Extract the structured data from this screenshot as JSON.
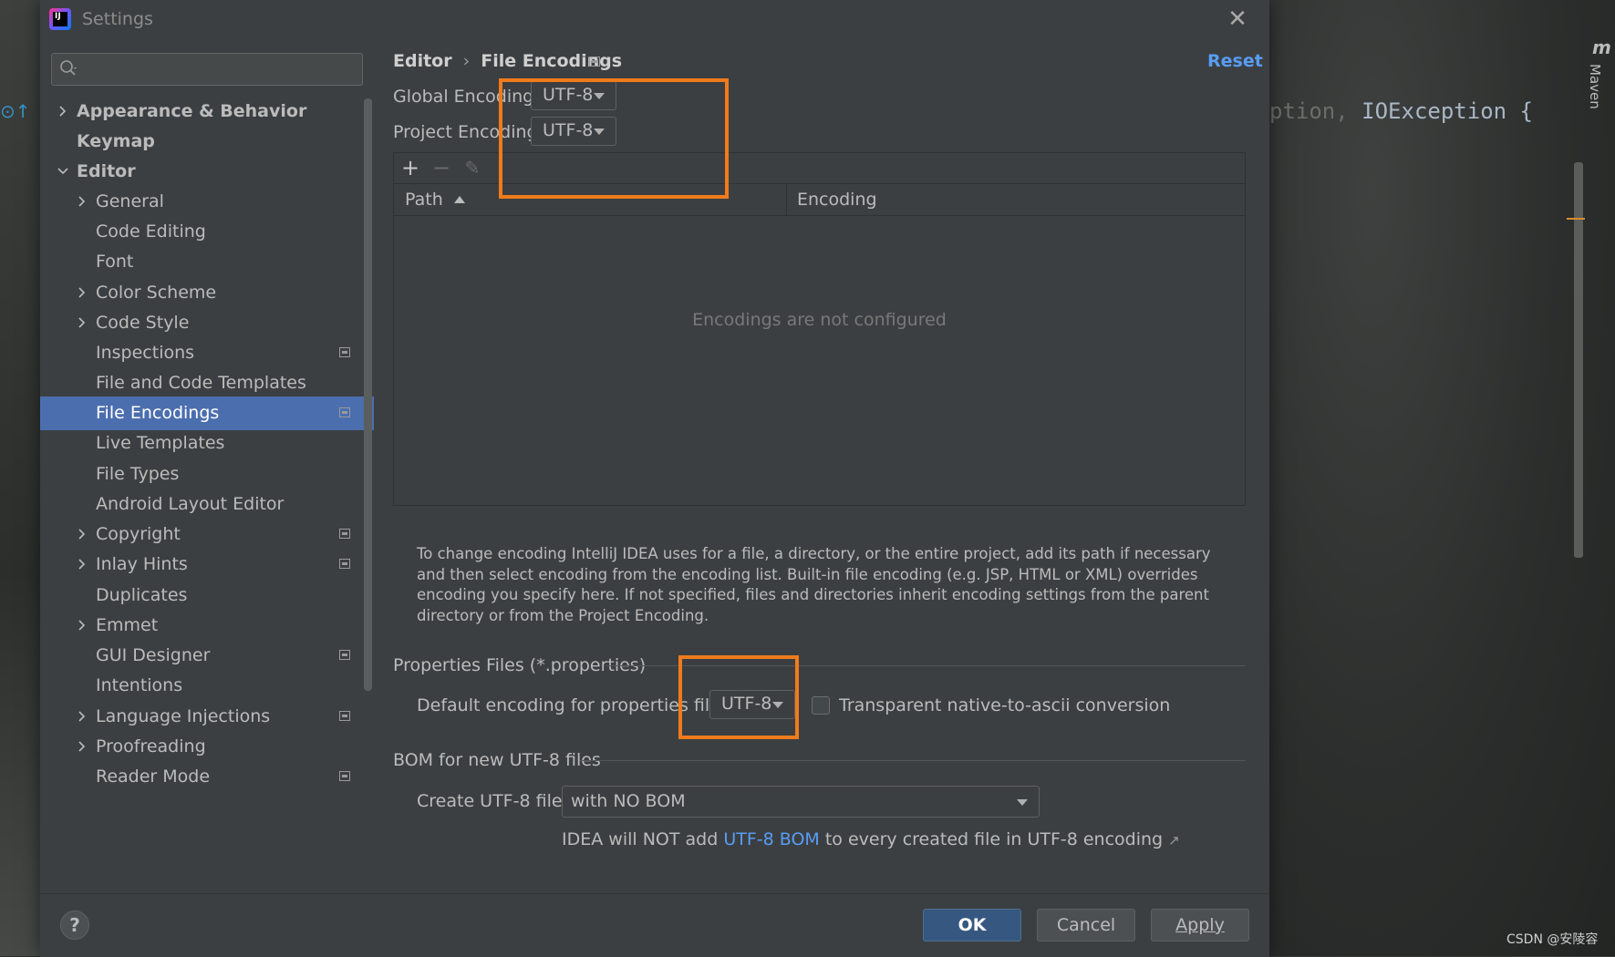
{
  "dialog": {
    "title": "Settings",
    "search_placeholder": ""
  },
  "sidebar": {
    "items": [
      {
        "label": "Appearance & Behavior"
      },
      {
        "label": "Keymap"
      },
      {
        "label": "Editor"
      },
      {
        "label": "General"
      },
      {
        "label": "Code Editing"
      },
      {
        "label": "Font"
      },
      {
        "label": "Color Scheme"
      },
      {
        "label": "Code Style"
      },
      {
        "label": "Inspections"
      },
      {
        "label": "File and Code Templates"
      },
      {
        "label": "File Encodings"
      },
      {
        "label": "Live Templates"
      },
      {
        "label": "File Types"
      },
      {
        "label": "Android Layout Editor"
      },
      {
        "label": "Copyright"
      },
      {
        "label": "Inlay Hints"
      },
      {
        "label": "Duplicates"
      },
      {
        "label": "Emmet"
      },
      {
        "label": "GUI Designer"
      },
      {
        "label": "Intentions"
      },
      {
        "label": "Language Injections"
      },
      {
        "label": "Proofreading"
      },
      {
        "label": "Reader Mode"
      }
    ],
    "selected": "File Encodings"
  },
  "header": {
    "breadcrumb_parent": "Editor",
    "breadcrumb_sep": "›",
    "breadcrumb_current": "File Encodings",
    "reset_label": "Reset"
  },
  "encodings": {
    "global_label": "Global Encoding:",
    "global_value": "UTF-8",
    "project_label": "Project Encoding:",
    "project_value": "UTF-8"
  },
  "toolbar": {
    "add": "+",
    "remove": "−",
    "edit": "✎"
  },
  "table": {
    "columns": [
      "Path",
      "Encoding"
    ],
    "empty_text": "Encodings are not configured"
  },
  "help_text": "To change encoding IntelliJ IDEA uses for a file, a directory, or the entire project, add its path if necessary and then select encoding from the encoding list. Built-in file encoding (e.g. JSP, HTML or XML) overrides encoding you specify here. If not specified, files and directories inherit encoding settings from the parent directory or from the Project Encoding.",
  "properties": {
    "section_title": "Properties Files (*.properties)",
    "default_label": "Default encoding for properties files:",
    "default_value": "UTF-8",
    "transparent_label": "Transparent native-to-ascii conversion",
    "transparent_checked": false
  },
  "bom": {
    "section_title": "BOM for new UTF-8 files",
    "create_label": "Create UTF-8 files:",
    "create_value": "with NO BOM",
    "note_prefix": "IDEA will NOT add",
    "note_link": "UTF-8 BOM",
    "note_suffix": "to every created file in UTF-8 encoding",
    "note_arrow": "↗"
  },
  "footer": {
    "help": "?",
    "ok": "OK",
    "cancel": "Cancel",
    "apply": "Apply"
  },
  "background": {
    "code_tail": "ption,",
    "code_rest": " IOException {",
    "maven_m": "m",
    "maven_label": "Maven",
    "watermark": "CSDN @安陵容"
  },
  "colors": {
    "accent": "#4b6eaf",
    "link": "#589df6",
    "highlight": "#f07b1c"
  }
}
